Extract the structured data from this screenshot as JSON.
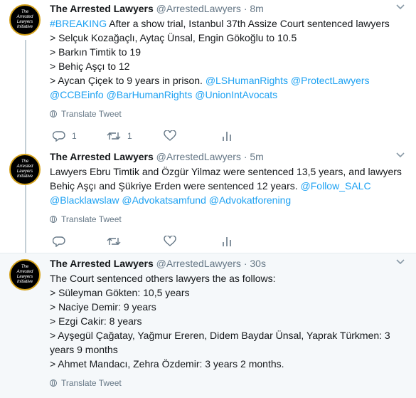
{
  "tweets": [
    {
      "author_name": "The Arrested Lawyers",
      "handle": "@ArrestedLawyers",
      "dot": "·",
      "time": "8m",
      "lines": [
        [
          {
            "t": "#BREAKING",
            "link": true
          },
          {
            "t": " After a show trial, Istanbul 37th Assize Court sentenced lawyers",
            "link": false
          }
        ],
        [
          {
            "t": "> Selçuk Kozağaçlı, Aytaç Ünsal, Engin Gökoğlu to 10.5",
            "link": false
          }
        ],
        [
          {
            "t": "> Barkın Timtik to 19",
            "link": false
          }
        ],
        [
          {
            "t": "> Behiç Aşçı to 12",
            "link": false
          }
        ],
        [
          {
            "t": "> Aycan Çiçek to 9 years in prison. ",
            "link": false
          },
          {
            "t": "@LSHumanRights",
            "link": true
          },
          {
            "t": " ",
            "link": false
          },
          {
            "t": "@ProtectLawyers",
            "link": true
          }
        ],
        [
          {
            "t": "@CCBEinfo",
            "link": true
          },
          {
            "t": " ",
            "link": false
          },
          {
            "t": "@BarHumanRights",
            "link": true
          },
          {
            "t": " ",
            "link": false
          },
          {
            "t": "@UnionIntAvocats",
            "link": true
          }
        ]
      ],
      "translate_label": "Translate Tweet",
      "reply_count": "1",
      "retweet_count": "1"
    },
    {
      "author_name": "The Arrested Lawyers",
      "handle": "@ArrestedLawyers",
      "dot": "·",
      "time": "5m",
      "lines": [
        [
          {
            "t": "Lawyers Ebru Timtik and Özgür Yilmaz were sentenced 13,5 years, and lawyers",
            "link": false
          }
        ],
        [
          {
            "t": "Behiç Aşçı and Şükriye Erden were sentenced 12 years. ",
            "link": false
          },
          {
            "t": "@Follow_SALC",
            "link": true
          }
        ],
        [
          {
            "t": "@Blacklawslaw",
            "link": true
          },
          {
            "t": " ",
            "link": false
          },
          {
            "t": "@Advokatsamfund",
            "link": true
          },
          {
            "t": " ",
            "link": false
          },
          {
            "t": "@Advokatforening",
            "link": true
          }
        ]
      ],
      "translate_label": "Translate Tweet",
      "reply_count": "",
      "retweet_count": ""
    },
    {
      "author_name": "The Arrested Lawyers",
      "handle": "@ArrestedLawyers",
      "dot": "·",
      "time": "30s",
      "lines": [
        [
          {
            "t": "The Court sentenced others lawyers the as follows:",
            "link": false
          }
        ],
        [
          {
            "t": "> Süleyman Gökten: 10,5 years",
            "link": false
          }
        ],
        [
          {
            "t": "> Naciye Demir: 9 years",
            "link": false
          }
        ],
        [
          {
            "t": "> Ezgi Cakir: 8 years",
            "link": false
          }
        ],
        [
          {
            "t": "> Ayşegül Çağatay, Yağmur Ereren, Didem Baydar Ünsal, Yaprak Türkmen: 3",
            "link": false
          }
        ],
        [
          {
            "t": "years 9 months",
            "link": false
          }
        ],
        [
          {
            "t": "> Ahmet Mandacı, Zehra Özdemir: 3 years 2 months.",
            "link": false
          }
        ]
      ],
      "translate_label": "Translate Tweet"
    }
  ],
  "avatar_text": [
    "The",
    "Arrested",
    "Lawyers",
    "Initiative"
  ],
  "colors": {
    "link": "#1da1f2",
    "muted": "#657786",
    "thread": "#c4cfd6"
  }
}
